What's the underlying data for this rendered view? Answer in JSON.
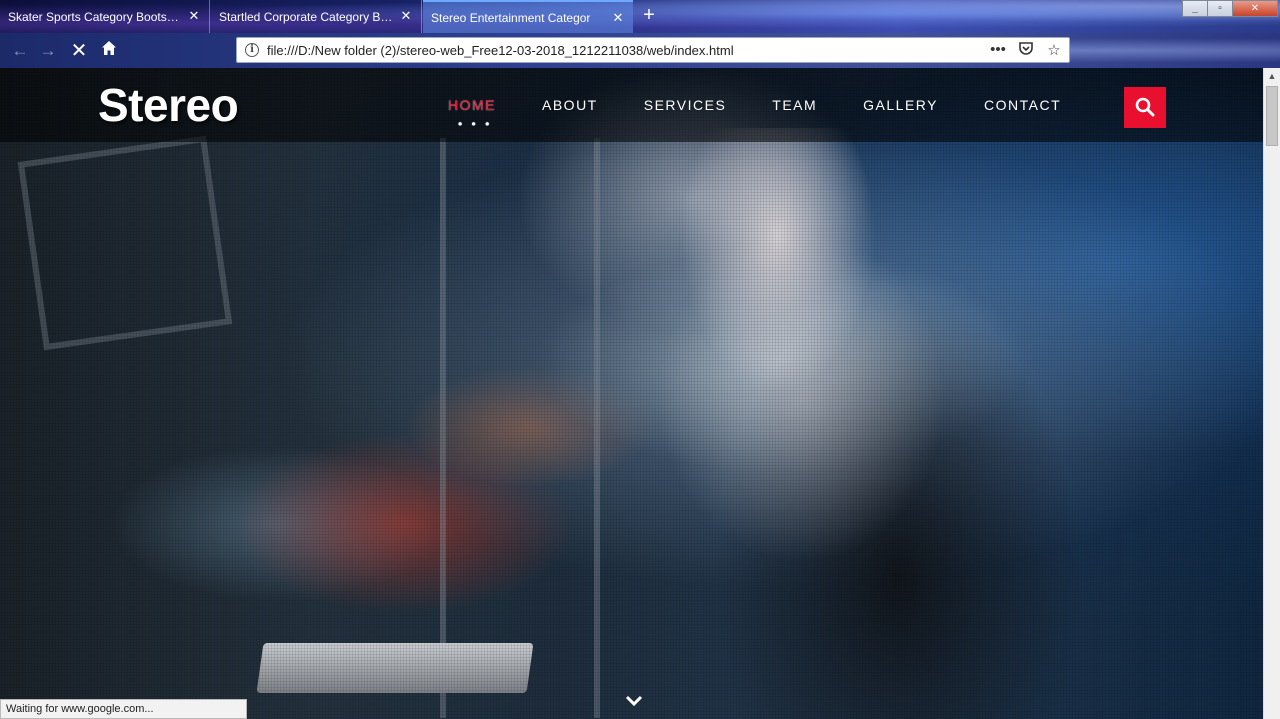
{
  "browser": {
    "tabs": [
      {
        "title": "Skater Sports Category Bootstrap R"
      },
      {
        "title": "Startled Corporate Category Bootst"
      },
      {
        "title": "Stereo Entertainment Categor"
      }
    ],
    "active_tab_index": 2,
    "new_tab_symbol": "+",
    "url": "file:///D:/New folder (2)/stereo-web_Free12-03-2018_1212211038/web/index.html",
    "status_text": "Waiting for www.google.com...",
    "icons": {
      "back": "back-arrow-icon",
      "forward": "forward-arrow-icon",
      "stop": "stop-loading-icon",
      "home": "home-icon",
      "page_info": "info-icon",
      "page_actions": "more-dots-icon",
      "pocket": "pocket-icon",
      "bookmark": "star-icon",
      "library": "library-icon",
      "sidebar": "sidebar-icon",
      "menu": "hamburger-menu-icon"
    }
  },
  "site": {
    "logo": "Stereo",
    "nav": [
      {
        "label": "HOME",
        "active": true
      },
      {
        "label": "ABOUT"
      },
      {
        "label": "SERVICES"
      },
      {
        "label": "TEAM"
      },
      {
        "label": "GALLERY"
      },
      {
        "label": "CONTACT"
      }
    ],
    "active_indicator": "• • •",
    "accent_color": "#e8102e",
    "search_icon": "search-icon",
    "scroll_icon": "chevron-down-icon"
  }
}
